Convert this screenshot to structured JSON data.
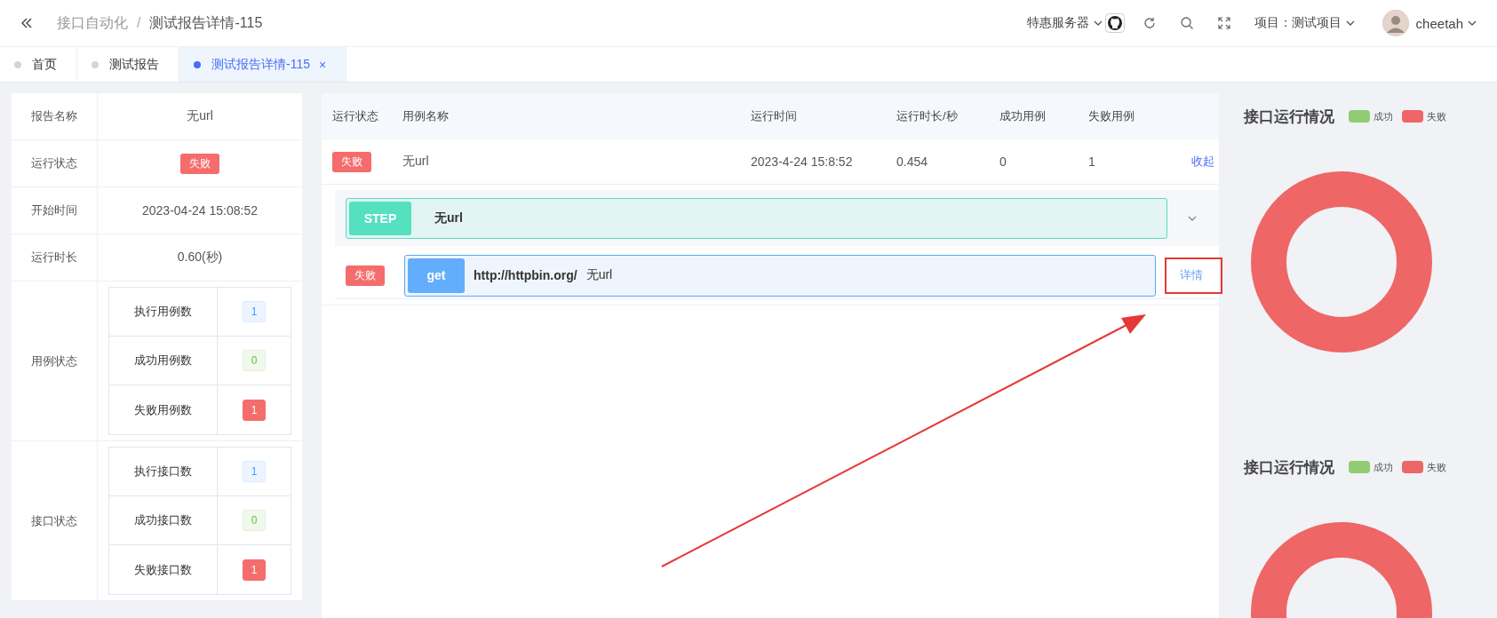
{
  "header": {
    "breadcrumb": [
      "接口自动化",
      "测试报告详情-115"
    ],
    "separator": "/",
    "server_menu": "特惠服务器",
    "project_menu": "项目：测试项目",
    "user": "cheetah"
  },
  "tabs": [
    {
      "label": "首页",
      "selected": false
    },
    {
      "label": "测试报告",
      "selected": false
    },
    {
      "label": "测试报告详情-115",
      "selected": true,
      "close": "×"
    }
  ],
  "summary": [
    {
      "label": "报告名称",
      "kind": "text",
      "value": "无url"
    },
    {
      "label": "运行状态",
      "kind": "status",
      "value": "失败",
      "ok": false
    },
    {
      "label": "开始时间",
      "kind": "text",
      "value": "2023-04-24 15:08:52"
    },
    {
      "label": "运行时长",
      "kind": "text",
      "value": "0.60(秒)"
    },
    {
      "label": "用例状态",
      "kind": "counts",
      "counts": [
        {
          "label": "执行用例数",
          "value": "1",
          "kind": "total"
        },
        {
          "label": "成功用例数",
          "value": "0",
          "kind": "success"
        },
        {
          "label": "失败用例数",
          "value": "1",
          "kind": "fail"
        }
      ]
    },
    {
      "label": "接口状态",
      "kind": "counts",
      "counts": [
        {
          "label": "执行接口数",
          "value": "1",
          "kind": "total"
        },
        {
          "label": "成功接口数",
          "value": "0",
          "kind": "success"
        },
        {
          "label": "失败接口数",
          "value": "1",
          "kind": "fail"
        }
      ]
    }
  ],
  "cases": {
    "columns": [
      "运行状态",
      "用例名称",
      "运行时间",
      "运行时长/秒",
      "成功用例",
      "失败用例"
    ],
    "rows": [
      {
        "status": "失败",
        "ok": false,
        "name": "无url",
        "time": "2023-4-24 15:8:52",
        "duration": "0.454",
        "passed": "0",
        "failed": "1",
        "action": "收起",
        "expanded": true,
        "steps": [
          {
            "tag": "STEP",
            "name": "无url",
            "requests": [
              {
                "status": "失败",
                "ok": false,
                "method": "get",
                "url": "http://httpbin.org/",
                "name": "无url",
                "action": "详情",
                "highlighted": true
              }
            ]
          }
        ]
      }
    ]
  },
  "charts": [
    {
      "title": "接口运行情况",
      "legend": [
        {
          "label": "成功",
          "color": "#91cc75"
        },
        {
          "label": "失败",
          "color": "#ee6666"
        }
      ]
    },
    {
      "title": "接口运行情况",
      "legend": [
        {
          "label": "成功",
          "color": "#91cc75"
        },
        {
          "label": "失败",
          "color": "#ee6666"
        }
      ]
    }
  ],
  "arrow": true
}
